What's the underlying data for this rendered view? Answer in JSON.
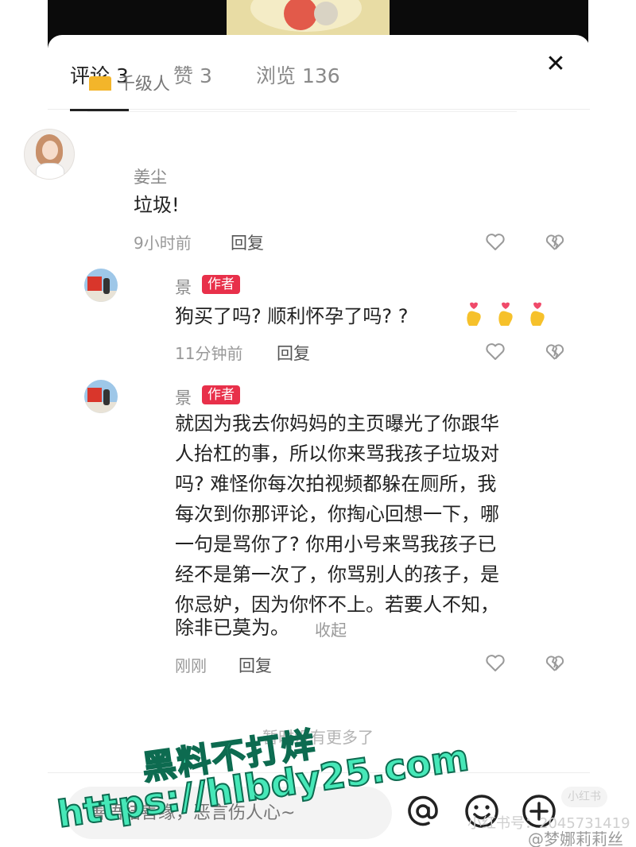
{
  "tabs": [
    {
      "label": "评论 3",
      "active": true
    },
    {
      "label": "赞 3",
      "active": false
    },
    {
      "label": "浏览 136",
      "active": false
    }
  ],
  "close_label": "✕",
  "ghost_tag": "千级人",
  "comments": [
    {
      "username": "姜尘",
      "text": "垃圾!",
      "time": "9小时前",
      "reply": "回复"
    },
    {
      "username": "景",
      "badge": "作者",
      "text": "狗买了吗? 顺利怀孕了吗? ?",
      "emoji": [
        "finger-heart-emoji",
        "finger-heart-emoji",
        "finger-heart-emoji"
      ],
      "time": "11分钟前",
      "reply": "回复"
    },
    {
      "username": "景",
      "badge": "作者",
      "lines": [
        "就因为我去你妈妈的主页曝光了你跟华",
        "人抬杠的事，所以你来骂我孩子垃圾对",
        "吗? 难怪你每次拍视频都躲在厕所，我",
        "每次到你那评论，你掏心回想一下，哪",
        "一句是骂你了? 你用小号来骂我孩子已",
        "经不是第一次了，你骂别人的孩子，是",
        "你忌妒，因为你怀不上。若要人不知，",
        "除非已莫为。"
      ],
      "collapse": "收起",
      "time": "刚刚",
      "reply": "回复"
    }
  ],
  "no_more": "暂时没有更多了",
  "input": {
    "placeholder": "善语结善缘，恶言伤人心~"
  },
  "icons": {
    "like": "heart-outline-icon",
    "dislike": "broken-heart-icon",
    "at": "at-icon",
    "emoji": "smiley-icon",
    "add": "plus-circle-icon"
  },
  "watermark": {
    "line1": "黑料不打烊",
    "line2": "https://hlbdy25.com",
    "corner": "小红书号：2045731419",
    "weibo": "@梦娜莉莉丝",
    "small_logo": "小红书"
  },
  "colors": {
    "author_badge": "#e8304a",
    "watermark_fill": "#46e8b8"
  }
}
